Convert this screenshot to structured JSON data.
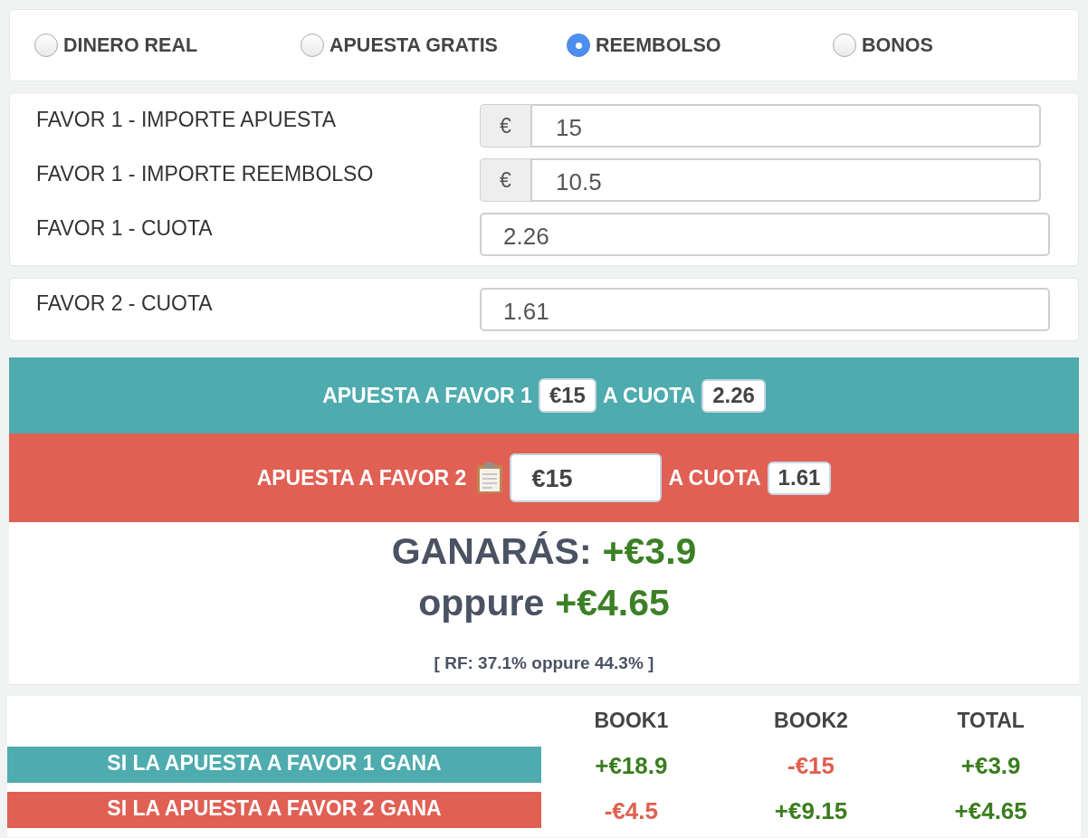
{
  "bet_types": [
    {
      "label": "DINERO REAL",
      "selected": false
    },
    {
      "label": "APUESTA GRATIS",
      "selected": false
    },
    {
      "label": "REEMBOLSO",
      "selected": true
    },
    {
      "label": "BONOS",
      "selected": false
    }
  ],
  "favor_1_fields": [
    {
      "label": "FAVOR 1 - IMPORTE APUESTA",
      "prefix": "€",
      "value": "15"
    },
    {
      "label": "FAVOR 1 - IMPORTE REEMBOLSO",
      "prefix": "€",
      "value": "10.5"
    },
    {
      "label": "FAVOR 1 - CUOTA",
      "value": "2.26"
    }
  ],
  "favor_2_fields": [
    {
      "label": "FAVOR 2 - CUOTA",
      "value": "1.61"
    }
  ],
  "bet_instructions": [
    {
      "kind": "badge",
      "color": "#4eabae",
      "label": "APUESTA A FAVOR 1",
      "amount": "€15",
      "odds_label": "A CUOTA",
      "odds": "2.26"
    },
    {
      "kind": "input",
      "color": "#e06054",
      "label": "APUESTA A FAVOR 2",
      "amount": "€15",
      "odds_label": "A CUOTA",
      "odds": "1.61"
    }
  ],
  "result": {
    "lines": [
      {
        "label": "GANARÁS:",
        "value": "+€3.9"
      },
      {
        "label": "oppure",
        "value": "+€4.65"
      }
    ],
    "note": "[ RF: 37.1% oppure 44.3% ]"
  },
  "table": {
    "columns": [
      "BOOK1",
      "BOOK2",
      "TOTAL"
    ],
    "rows": [
      {
        "label": "SI LA APUESTA A FAVOR 1 GANA",
        "color": "#4eabae",
        "cells": [
          {
            "value": "+€18.9",
            "color": "#3a7d1e"
          },
          {
            "value": "-€15",
            "color": "#e0604f"
          },
          {
            "value": "+€3.9",
            "color": "#3a7d1e"
          }
        ]
      },
      {
        "label": "SI LA APUESTA A FAVOR 2 GANA",
        "color": "#e06054",
        "cells": [
          {
            "value": "-€4.5",
            "color": "#e0604f"
          },
          {
            "value": "+€9.15",
            "color": "#3a7d1e"
          },
          {
            "value": "+€4.65",
            "color": "#3a7d1e"
          }
        ]
      }
    ]
  }
}
